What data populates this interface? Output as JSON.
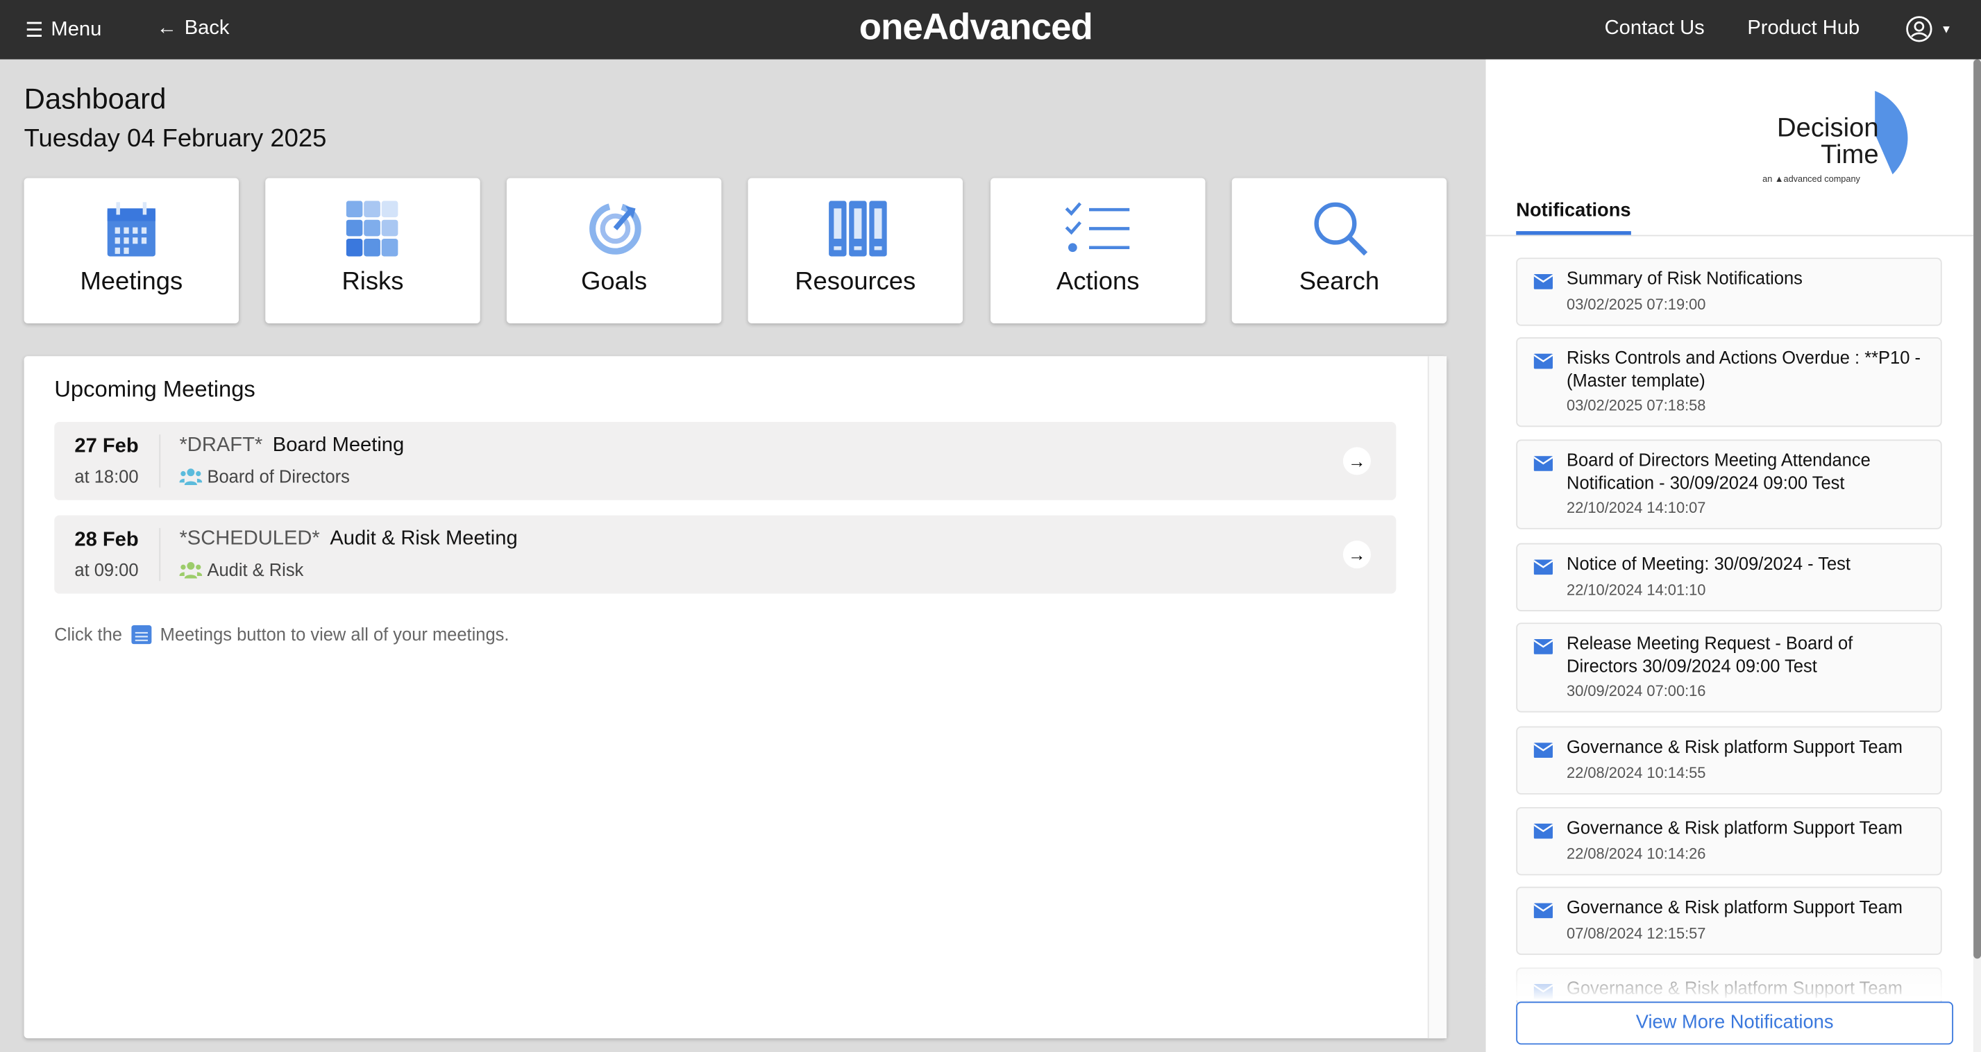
{
  "topbar": {
    "menu": "Menu",
    "back": "Back",
    "logo": "oneAdvanced",
    "contact": "Contact Us",
    "product_hub": "Product Hub"
  },
  "dashboard": {
    "title": "Dashboard",
    "date": "Tuesday 04 February 2025"
  },
  "tiles": [
    {
      "label": "Meetings",
      "icon": "calendar-icon"
    },
    {
      "label": "Risks",
      "icon": "grid-icon"
    },
    {
      "label": "Goals",
      "icon": "target-icon"
    },
    {
      "label": "Resources",
      "icon": "binders-icon"
    },
    {
      "label": "Actions",
      "icon": "checklist-icon"
    },
    {
      "label": "Search",
      "icon": "search-icon"
    }
  ],
  "meetings": {
    "title": "Upcoming Meetings",
    "items": [
      {
        "date": "27 Feb",
        "time": "at 18:00",
        "status": "*DRAFT*",
        "title": "Board Meeting",
        "group": "Board of Directors",
        "group_color": "#5bbbdc"
      },
      {
        "date": "28 Feb",
        "time": "at 09:00",
        "status": "*SCHEDULED*",
        "title": "Audit & Risk Meeting",
        "group": "Audit & Risk",
        "group_color": "#9ccc6a"
      }
    ],
    "hint_before": "Click the",
    "hint_after": "Meetings button to view all of your meetings."
  },
  "sidebar": {
    "logo_line1": "Decision",
    "logo_line2": "Time",
    "logo_tag": "an advanced company",
    "tab": "Notifications",
    "view_more": "View More Notifications",
    "notifications": [
      {
        "title": "Summary of Risk Notifications",
        "date": "03/02/2025 07:19:00"
      },
      {
        "title": "Risks Controls and Actions Overdue : **P10 - (Master template)",
        "date": "03/02/2025 07:18:58"
      },
      {
        "title": "Board of Directors Meeting Attendance Notification - 30/09/2024 09:00 Test",
        "date": "22/10/2024 14:10:07"
      },
      {
        "title": "Notice of Meeting: 30/09/2024 - Test",
        "date": "22/10/2024 14:01:10"
      },
      {
        "title": "Release Meeting Request - Board of Directors 30/09/2024 09:00 Test",
        "date": "30/09/2024 07:00:16"
      },
      {
        "title": "Governance & Risk platform Support Team",
        "date": "22/08/2024 10:14:55"
      },
      {
        "title": "Governance & Risk platform Support Team",
        "date": "22/08/2024 10:14:26"
      },
      {
        "title": "Governance & Risk platform Support Team",
        "date": "07/08/2024 12:15:57"
      },
      {
        "title": "Governance & Risk platform Support Team",
        "date": ""
      }
    ]
  },
  "colors": {
    "accent": "#3a78dd",
    "topbar": "#2f2f2f"
  }
}
